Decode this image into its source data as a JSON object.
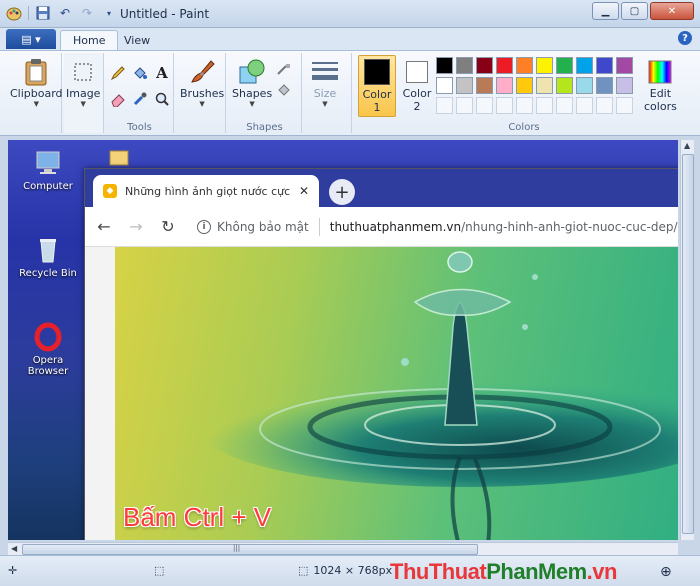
{
  "window": {
    "title": "Untitled - Paint"
  },
  "tabs": [
    "Home",
    "View"
  ],
  "ribbon": {
    "clipboard_label": "Clipboard",
    "image_label": "Image",
    "tools_label": "Tools",
    "brushes_label": "Brushes",
    "shapes_button_label": "Shapes",
    "shapes_group_label": "Shapes",
    "size_label": "Size",
    "color1_label": "Color 1",
    "color1_line1": "Color",
    "color1_line2": "1",
    "color2_line1": "Color",
    "color2_line2": "2",
    "edit_colors_line1": "Edit",
    "edit_colors_line2": "colors",
    "colors_label": "Colors",
    "color1_value": "#000000",
    "color2_value": "#ffffff",
    "palette_row1": [
      "#000000",
      "#7f7f7f",
      "#880015",
      "#ed1c24",
      "#ff7f27",
      "#fff200",
      "#22b14c",
      "#00a2e8",
      "#3f48cc",
      "#a349a4"
    ],
    "palette_row2": [
      "#ffffff",
      "#c3c3c3",
      "#b97a57",
      "#ffaec9",
      "#ffc90e",
      "#efe4b0",
      "#b5e61d",
      "#99d9ea",
      "#7092be",
      "#c8bfe7"
    ]
  },
  "desktop": {
    "icons": [
      {
        "label": "Computer",
        "icon": "computer-icon"
      },
      {
        "label": "Recycle Bin",
        "icon": "recycle-bin-icon"
      },
      {
        "label_line1": "Opera",
        "label_line2": "Browser",
        "icon": "opera-icon"
      }
    ]
  },
  "browser": {
    "tab_title": "Những hình ảnh giọt nước cực đ",
    "security_text": "Không bảo mật",
    "url_domain": "thuthuatphanmem.vn",
    "url_path": "/nhung-hinh-anh-giot-nuoc-cuc-dep/",
    "image_caption": "Bấm Ctrl + V"
  },
  "statusbar": {
    "dimensions": "1024 × 768px"
  },
  "watermark": {
    "part1": "Thu",
    "part2": "Thuat",
    "part3": "PhanMem",
    "part4": ".vn"
  }
}
